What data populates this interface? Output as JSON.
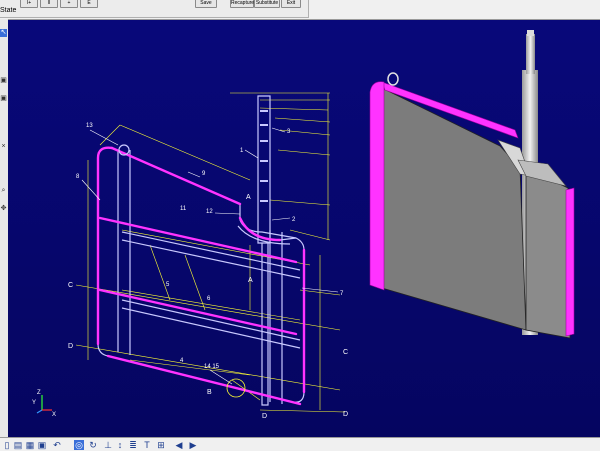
{
  "toolbar": {
    "state_label": "State",
    "buttons": [
      "I+",
      "II",
      "+",
      "Ε",
      "Save",
      "Recapture",
      "Substitute",
      "Exit"
    ]
  },
  "left_toolbar_icons": [
    "select-arrow-icon",
    "view-icon",
    "view-icon",
    "close-icon",
    "zoom-icon",
    "pan-icon"
  ],
  "bottom_toolbar_icons": [
    "new-icon",
    "open-icon",
    "save-icon",
    "print-icon",
    "undo-icon",
    "snap-icon",
    "rotate-icon",
    "measure-icon",
    "dimension-icon",
    "layer-icon",
    "text-icon",
    "section-icon",
    "arrow-left-icon",
    "arrow-right-icon"
  ],
  "drawing": {
    "part_numbers": [
      "1",
      "2",
      "3",
      "4",
      "5",
      "6",
      "7",
      "8",
      "9",
      "11",
      "12",
      "13",
      "14 15"
    ],
    "section_markers": [
      "A",
      "A",
      "B",
      "C",
      "C",
      "D",
      "D",
      "D"
    ],
    "axis_labels": [
      "Z",
      "Y",
      "X"
    ]
  },
  "colors": {
    "viewport_bg": "#0a0a7a",
    "highlight": "#ff33ff",
    "outline": "#c0c0ff",
    "dimension": "#ffff00",
    "model_face": "#7c7c7c"
  }
}
